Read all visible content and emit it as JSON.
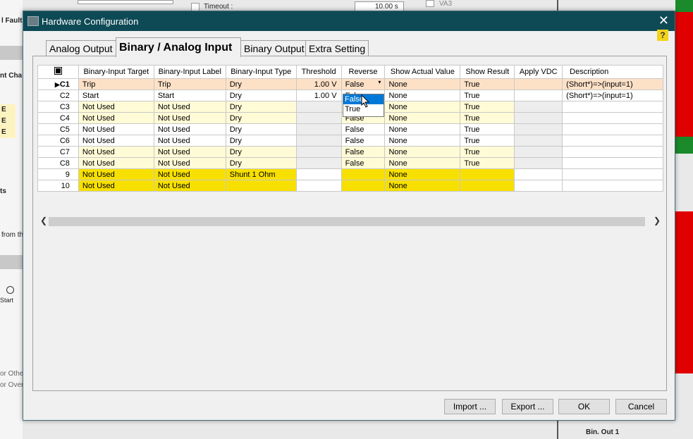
{
  "background": {
    "fault_text": "l Fault",
    "timeout_label": "Timeout :",
    "timeout_value": "10.00 s",
    "va3_label": "VA3",
    "chart_text": "nt Cha",
    "e_labels": [
      "E",
      "E",
      "E"
    ],
    "ts_text": "ts",
    "from_text": "from th",
    "start_text": "Start",
    "other_text": "or Other",
    "over_text": "or Over",
    "bin_out": "Bin. Out 1"
  },
  "dialog": {
    "title": "Hardware Configuration",
    "close_glyph": "✕",
    "help_glyph": "?",
    "tabs": [
      {
        "label": "Analog Output"
      },
      {
        "label": "Binary / Analog Input"
      },
      {
        "label": "Binary Output"
      },
      {
        "label": "Extra Setting"
      }
    ]
  },
  "grid": {
    "columns": [
      "Binary-Input Target",
      "Binary-Input Label",
      "Binary-Input Type",
      "Threshold",
      "Reverse",
      "Show Actual Value",
      "Show Result",
      "Apply VDC",
      "Description"
    ],
    "rows": [
      {
        "id": "C1",
        "target": "Trip",
        "label": "Trip",
        "type": "Dry",
        "threshold": "1.00 V",
        "reverse": "False",
        "actual": "None",
        "result": "True",
        "vdc": "",
        "desc": "(Short*)=>(input=1)"
      },
      {
        "id": "C2",
        "target": "Start",
        "label": "Start",
        "type": "Dry",
        "threshold": "1.00 V",
        "reverse": "False",
        "actual": "None",
        "result": "True",
        "vdc": "",
        "desc": "(Short*)=>(input=1)"
      },
      {
        "id": "C3",
        "target": "Not Used",
        "label": "Not Used",
        "type": "Dry",
        "threshold": "",
        "reverse": "False",
        "actual": "None",
        "result": "True",
        "vdc": "",
        "desc": ""
      },
      {
        "id": "C4",
        "target": "Not Used",
        "label": "Not Used",
        "type": "Dry",
        "threshold": "",
        "reverse": "False",
        "actual": "None",
        "result": "True",
        "vdc": "",
        "desc": ""
      },
      {
        "id": "C5",
        "target": "Not Used",
        "label": "Not Used",
        "type": "Dry",
        "threshold": "",
        "reverse": "False",
        "actual": "None",
        "result": "True",
        "vdc": "",
        "desc": ""
      },
      {
        "id": "C6",
        "target": "Not Used",
        "label": "Not Used",
        "type": "Dry",
        "threshold": "",
        "reverse": "False",
        "actual": "None",
        "result": "True",
        "vdc": "",
        "desc": ""
      },
      {
        "id": "C7",
        "target": "Not Used",
        "label": "Not Used",
        "type": "Dry",
        "threshold": "",
        "reverse": "False",
        "actual": "None",
        "result": "True",
        "vdc": "",
        "desc": ""
      },
      {
        "id": "C8",
        "target": "Not Used",
        "label": "Not Used",
        "type": "Dry",
        "threshold": "",
        "reverse": "False",
        "actual": "None",
        "result": "True",
        "vdc": "",
        "desc": ""
      },
      {
        "id": "9",
        "target": "Not Used",
        "label": "Not Used",
        "type": "Shunt 1 Ohm",
        "threshold": "",
        "reverse": "",
        "actual": "None",
        "result": "",
        "vdc": "",
        "desc": ""
      },
      {
        "id": "10",
        "target": "Not Used",
        "label": "Not Used",
        "type": "",
        "threshold": "",
        "reverse": "",
        "actual": "None",
        "result": "",
        "vdc": "",
        "desc": ""
      }
    ],
    "current_row_marker": "▶",
    "dropdown_options": [
      "False",
      "True"
    ]
  },
  "buttons": {
    "import": "Import ...",
    "export": "Export ...",
    "ok": "OK",
    "cancel": "Cancel"
  },
  "colors": {
    "titlebar": "#0e4a55",
    "yellow_bright": "#f7e000",
    "yellow_light": "#fffbd6",
    "selected_row": "#fde1c7",
    "red_block": "#e00000",
    "green_block": "#1a8a2a"
  }
}
